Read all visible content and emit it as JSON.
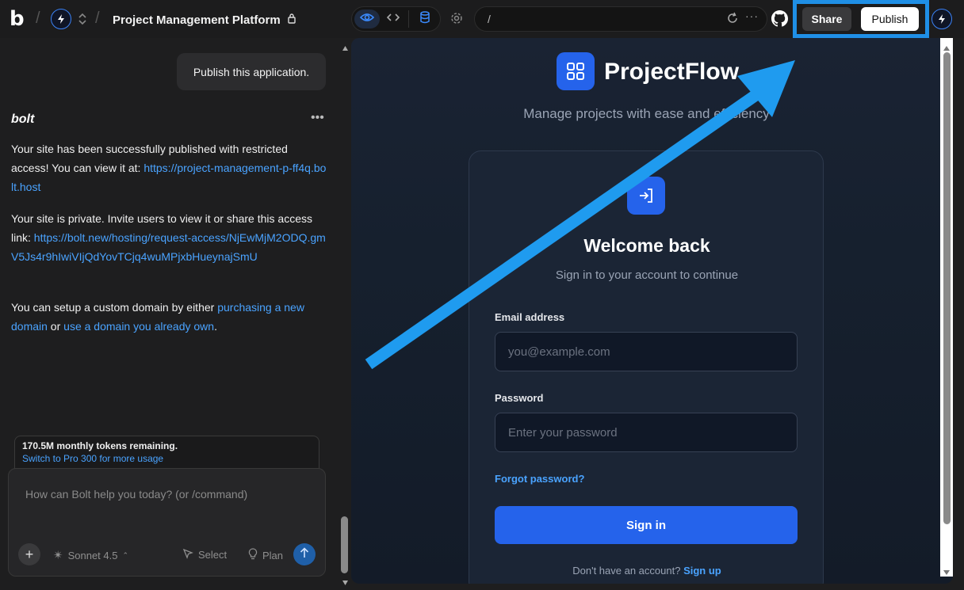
{
  "topbar": {
    "project_title": "Project Management Platform",
    "url_path": "/",
    "share_label": "Share",
    "publish_label": "Publish"
  },
  "chat": {
    "user_message": "Publish this application.",
    "assistant_name": "bolt",
    "para1_text": "Your site has been successfully published with restricted access! You can view it at: ",
    "para1_link": "https://project-management-p-ff4q.bolt.host",
    "para2_text": "Your site is private. Invite users to view it or share this access link: ",
    "para2_link": "https://bolt.new/hosting/request-access/NjEwMjM2ODQ.gmV5Js4r9hIwiVIjQdYovTCjq4wuMPjxbHueynajSmU",
    "para3_text": "You can setup a custom domain by either ",
    "para3_link1": "purchasing a new domain",
    "para3_or": " or ",
    "para3_link2": "use a domain you already own",
    "para3_end": ".",
    "tokens_remaining": "170.5M monthly tokens remaining.",
    "upgrade_link": "Switch to Pro 300 for more usage",
    "input_placeholder": "How can Bolt help you today? (or /command)",
    "model_label": "Sonnet 4.5",
    "select_label": "Select",
    "plan_label": "Plan"
  },
  "preview": {
    "brand_name": "ProjectFlow",
    "tagline": "Manage projects with ease and efficiency",
    "welcome_title": "Welcome back",
    "welcome_sub": "Sign in to your account to continue",
    "email_label": "Email address",
    "email_placeholder": "you@example.com",
    "password_label": "Password",
    "password_placeholder": "Enter your password",
    "forgot_label": "Forgot password?",
    "signin_label": "Sign in",
    "signup_prompt": "Don't have an account? ",
    "signup_link": "Sign up"
  },
  "colors": {
    "accent": "#2563eb",
    "link": "#4aa3ff",
    "highlight": "#1f8fe6"
  }
}
